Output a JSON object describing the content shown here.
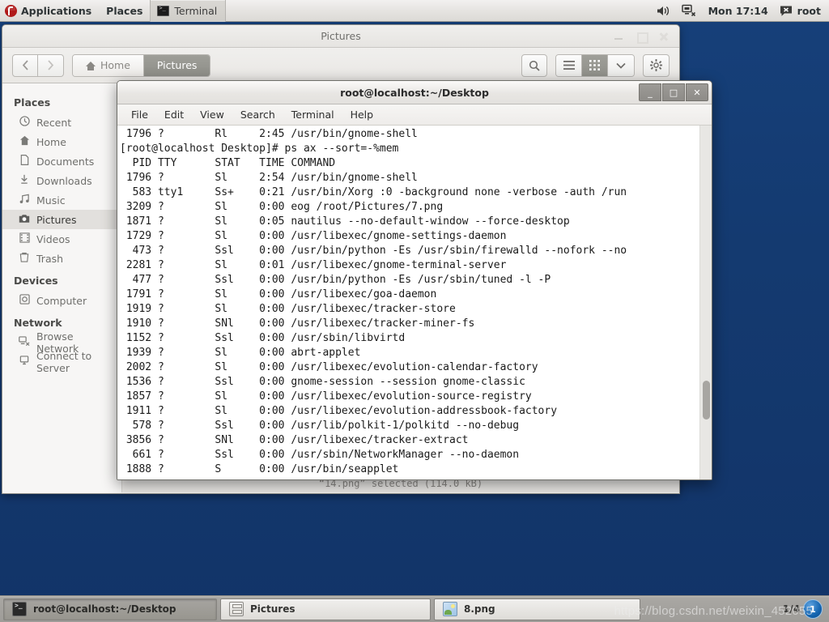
{
  "top_panel": {
    "logo_icon": "fedora-logo-icon",
    "applications_label": "Applications",
    "places_label": "Places",
    "window_button": {
      "label": "Terminal",
      "icon": "terminal-icon"
    },
    "tray": {
      "volume_icon": "speaker-icon",
      "network_icon": "network-disconnected-icon",
      "clock": "Mon 17:14",
      "user_icon": "user-session-icon",
      "user_label": "root"
    }
  },
  "nautilus": {
    "title": "Pictures",
    "window_buttons": {
      "minimize": "–",
      "maximize": "□",
      "close": "✕"
    },
    "nav": {
      "back_icon": "chevron-left-icon",
      "forward_icon": "chevron-right-icon"
    },
    "pathbar": [
      {
        "label": "Home",
        "icon": "home-icon",
        "active": false
      },
      {
        "label": "Pictures",
        "icon": "",
        "active": true
      }
    ],
    "toolbar": {
      "search_icon": "search-icon",
      "list_view_icon": "list-view-icon",
      "grid_view_icon": "grid-view-icon",
      "sort_icon": "chevron-down-icon",
      "menu_icon": "gear-icon"
    },
    "sidebar": {
      "groups": [
        {
          "heading": "Places",
          "items": [
            {
              "label": "Recent",
              "icon": "clock-icon",
              "selected": false
            },
            {
              "label": "Home",
              "icon": "home-icon",
              "selected": false
            },
            {
              "label": "Documents",
              "icon": "document-icon",
              "selected": false
            },
            {
              "label": "Downloads",
              "icon": "download-icon",
              "selected": false
            },
            {
              "label": "Music",
              "icon": "music-note-icon",
              "selected": false
            },
            {
              "label": "Pictures",
              "icon": "camera-icon",
              "selected": true
            },
            {
              "label": "Videos",
              "icon": "film-icon",
              "selected": false
            },
            {
              "label": "Trash",
              "icon": "trash-icon",
              "selected": false
            }
          ]
        },
        {
          "heading": "Devices",
          "items": [
            {
              "label": "Computer",
              "icon": "computer-icon",
              "selected": false
            }
          ]
        },
        {
          "heading": "Network",
          "items": [
            {
              "label": "Browse Network",
              "icon": "network-icon",
              "selected": false
            },
            {
              "label": "Connect to Server",
              "icon": "server-icon",
              "selected": false
            }
          ]
        }
      ]
    },
    "status": "“14.png” selected (114.0 kB)"
  },
  "terminal": {
    "title": "root@localhost:~/Desktop",
    "window_buttons": {
      "minimize": "_",
      "maximize": "□",
      "close": "✕"
    },
    "menus": [
      "File",
      "Edit",
      "View",
      "Search",
      "Terminal",
      "Help"
    ],
    "lines": [
      " 1796 ?        Rl     2:45 /usr/bin/gnome-shell",
      "[root@localhost Desktop]# ps ax --sort=-%mem",
      "  PID TTY      STAT   TIME COMMAND",
      " 1796 ?        Sl     2:54 /usr/bin/gnome-shell",
      "  583 tty1     Ss+    0:21 /usr/bin/Xorg :0 -background none -verbose -auth /run",
      " 3209 ?        Sl     0:00 eog /root/Pictures/7.png",
      " 1871 ?        Sl     0:05 nautilus --no-default-window --force-desktop",
      " 1729 ?        Sl     0:00 /usr/libexec/gnome-settings-daemon",
      "  473 ?        Ssl    0:00 /usr/bin/python -Es /usr/sbin/firewalld --nofork --no",
      " 2281 ?        Sl     0:01 /usr/libexec/gnome-terminal-server",
      "  477 ?        Ssl    0:00 /usr/bin/python -Es /usr/sbin/tuned -l -P",
      " 1791 ?        Sl     0:00 /usr/libexec/goa-daemon",
      " 1919 ?        Sl     0:00 /usr/libexec/tracker-store",
      " 1910 ?        SNl    0:00 /usr/libexec/tracker-miner-fs",
      " 1152 ?        Ssl    0:00 /usr/sbin/libvirtd",
      " 1939 ?        Sl     0:00 abrt-applet",
      " 2002 ?        Sl     0:00 /usr/libexec/evolution-calendar-factory",
      " 1536 ?        Ssl    0:00 gnome-session --session gnome-classic",
      " 1857 ?        Sl     0:00 /usr/libexec/evolution-source-registry",
      " 1911 ?        Sl     0:00 /usr/libexec/evolution-addressbook-factory",
      "  578 ?        Ssl    0:00 /usr/lib/polkit-1/polkitd --no-debug",
      " 3856 ?        SNl    0:00 /usr/libexec/tracker-extract",
      "  661 ?        Ssl    0:00 /usr/sbin/NetworkManager --no-daemon",
      " 1888 ?        S      0:00 /usr/bin/seapplet"
    ],
    "scrollbar": {
      "icon": "scrollbar-thumb"
    }
  },
  "bottom_panel": {
    "tasks": [
      {
        "label": "root@localhost:~/Desktop",
        "icon": "terminal-icon",
        "active": true
      },
      {
        "label": "Pictures",
        "icon": "file-manager-icon",
        "active": false
      },
      {
        "label": "8.png",
        "icon": "image-viewer-icon",
        "active": false
      }
    ],
    "workspace": {
      "label": "1/4",
      "badge": "1"
    }
  },
  "watermark": "https://blog.csdn.net/weixin_452055",
  "colors": {
    "desktop_blue": "#12386b",
    "panel_grey": "#e6e4e1",
    "accent_selected": "#9f9f99",
    "terminal_bg": "#ffffff",
    "terminal_fg": "#1a1a1a"
  }
}
